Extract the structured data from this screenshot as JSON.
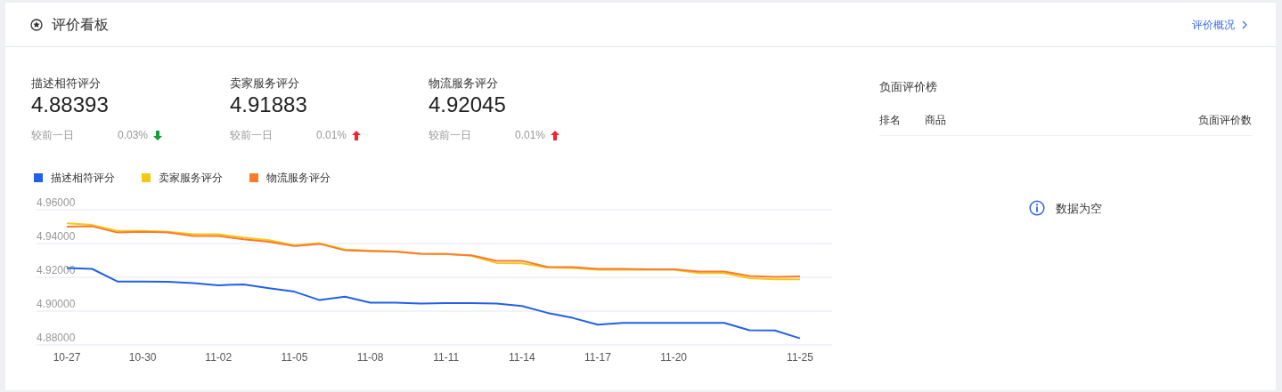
{
  "header": {
    "title": "评价看板",
    "link": "评价概况"
  },
  "metrics": [
    {
      "label": "描述相符评分",
      "value": "4.88393",
      "compare_label": "较前一日",
      "change": "0.03%",
      "up": false
    },
    {
      "label": "卖家服务评分",
      "value": "4.91883",
      "compare_label": "较前一日",
      "change": "0.01%",
      "up": true
    },
    {
      "label": "物流服务评分",
      "value": "4.92045",
      "compare_label": "较前一日",
      "change": "0.01%",
      "up": true
    }
  ],
  "chart_data": {
    "type": "line",
    "categories": [
      "10-27",
      null,
      null,
      "10-30",
      null,
      null,
      "11-02",
      null,
      null,
      "11-05",
      null,
      null,
      "11-08",
      null,
      null,
      "11-11",
      null,
      null,
      "11-14",
      null,
      null,
      "11-17",
      null,
      null,
      "11-20",
      null,
      null,
      null,
      null,
      "11-25"
    ],
    "grid": true,
    "ylim": [
      4.88,
      4.96
    ],
    "yticks": [
      {
        "value": 4.96,
        "label": "4.96000"
      },
      {
        "value": 4.94,
        "label": "4.94000"
      },
      {
        "value": 4.92,
        "label": "4.92000"
      },
      {
        "value": 4.9,
        "label": "4.90000"
      },
      {
        "value": 4.88,
        "label": "4.88000"
      }
    ],
    "series": [
      {
        "name": "描述相符评分",
        "color": "#2160e8",
        "values": [
          4.9255,
          4.925,
          4.9175,
          4.9175,
          4.9173,
          4.9165,
          4.9153,
          4.9158,
          4.9135,
          4.9115,
          4.9065,
          4.9085,
          4.905,
          4.905,
          4.9045,
          4.9047,
          4.9047,
          4.9045,
          4.903,
          4.899,
          4.896,
          4.892,
          4.893,
          4.893,
          4.893,
          4.893,
          4.893,
          4.8887,
          4.8886,
          4.8839
        ]
      },
      {
        "name": "卖家服务评分",
        "color": "#f5c817",
        "values": [
          4.952,
          4.951,
          4.9475,
          4.9475,
          4.947,
          4.9455,
          4.9455,
          4.9435,
          4.942,
          4.939,
          4.9402,
          4.9365,
          4.9358,
          4.9352,
          4.934,
          4.9338,
          4.9328,
          4.9285,
          4.9283,
          4.9258,
          4.9255,
          4.9245,
          4.9245,
          4.9245,
          4.9245,
          4.9225,
          4.9225,
          4.9195,
          4.9188,
          4.9188
        ]
      },
      {
        "name": "物流服务评分",
        "color": "#fa7b2c",
        "values": [
          4.95,
          4.9502,
          4.9465,
          4.947,
          4.9465,
          4.9445,
          4.9445,
          4.9425,
          4.941,
          4.9385,
          4.9398,
          4.936,
          4.9355,
          4.9352,
          4.934,
          4.9338,
          4.933,
          4.9298,
          4.9298,
          4.9262,
          4.926,
          4.925,
          4.925,
          4.9248,
          4.9248,
          4.9235,
          4.9235,
          4.9208,
          4.9203,
          4.9205
        ]
      }
    ]
  },
  "negative_ranking": {
    "title": "负面评价榜",
    "columns": [
      "排名",
      "商品",
      "负面评价数"
    ],
    "empty_text": "数据为空"
  }
}
